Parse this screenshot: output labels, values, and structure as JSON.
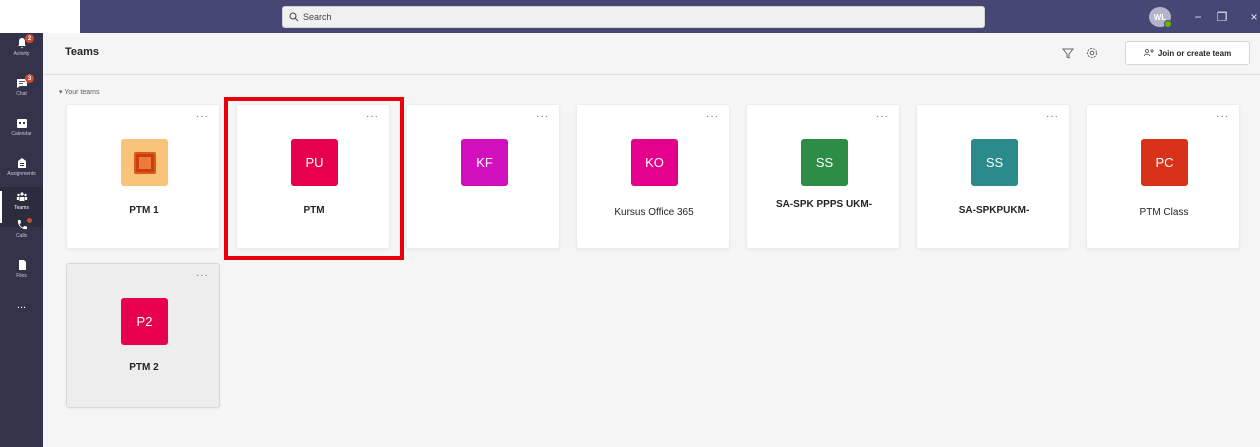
{
  "search": {
    "placeholder": "Search"
  },
  "user": {
    "initials": "WL"
  },
  "window_controls": {
    "minimize": "−",
    "restore": "❐",
    "close": "×"
  },
  "rail": {
    "items": [
      {
        "label": "Activity",
        "icon": "bell-icon",
        "badge": "2"
      },
      {
        "label": "Chat",
        "icon": "chat-icon",
        "badge": "3"
      },
      {
        "label": "Calendar",
        "icon": "calendar-icon"
      },
      {
        "label": "Assignments",
        "icon": "assignments-icon"
      },
      {
        "label": "Teams",
        "icon": "teams-icon",
        "active": true
      },
      {
        "label": "Calls",
        "icon": "phone-icon"
      },
      {
        "label": "Files",
        "icon": "files-icon"
      }
    ],
    "more": "..."
  },
  "header": {
    "title": "Teams",
    "join_label": "Join or create team"
  },
  "section": {
    "label": "Your teams"
  },
  "teams": [
    {
      "initials": "",
      "name": "PTM 1",
      "color": "#f8c47a",
      "bold": true,
      "image_tile": true
    },
    {
      "initials": "PU",
      "name": "PTM",
      "color": "#e6004d",
      "bold": true,
      "highlighted": true
    },
    {
      "initials": "KF",
      "name": "",
      "color": "#d20fbd",
      "bold": false
    },
    {
      "initials": "KO",
      "name": "Kursus Office 365",
      "color": "#e3008c",
      "bold": false
    },
    {
      "initials": "SS",
      "name": "SA-SPK PPPS UKM-",
      "color": "#2d8c46",
      "bold": true
    },
    {
      "initials": "SS",
      "name": "SA-SPKPUKM-",
      "color": "#2b8a8a",
      "bold": true
    },
    {
      "initials": "PC",
      "name": "PTM Class",
      "color": "#d8331a",
      "bold": false
    },
    {
      "initials": "P2",
      "name": "PTM 2",
      "color": "#e6004d",
      "bold": true,
      "hover": true
    }
  ],
  "card_more": "···",
  "colors": {
    "topbar": "#464775",
    "rail": "#33344a",
    "highlight": "#e8000b"
  }
}
